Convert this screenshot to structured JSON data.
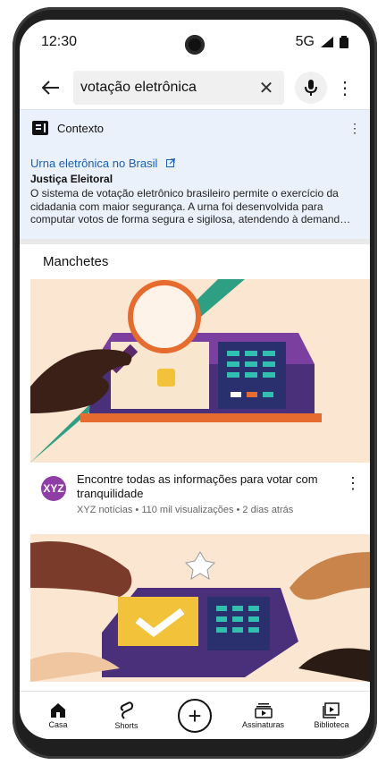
{
  "status": {
    "time": "12:30",
    "network": "5G"
  },
  "search": {
    "query": "votação eletrônica"
  },
  "context": {
    "title": "Contexto",
    "link": "Urna eletrônica no Brasil",
    "source": "Justiça Eleitoral",
    "description": "O sistema de votação eletrônico brasileiro permite o exercício da cidadania com maior segurança. A urna foi desenvolvida para computar votos de forma segura e sigilosa, atendendo à demand…"
  },
  "section_title": "Manchetes",
  "video": {
    "channel_avatar": "XYZ",
    "title": "Encontre todas as informações para votar com tranquilidade",
    "meta": "XYZ notícias • 110 mil visualizações • 2 dias atrás"
  },
  "bottom_nav": {
    "items": [
      {
        "label": "Casa"
      },
      {
        "label": "Shorts"
      },
      {
        "label": ""
      },
      {
        "label": "Assinaturas"
      },
      {
        "label": "Biblioteca"
      }
    ]
  },
  "colors": {
    "context_bg": "#eaf1fb",
    "link": "#1a5fb4",
    "thumb_bg": "#fbe6d1",
    "avatar": "#8e3ea4"
  },
  "icons": [
    "back-arrow-icon",
    "clear-icon",
    "mic-icon",
    "more-vert-icon",
    "context-icon",
    "external-link-icon",
    "home-icon",
    "shorts-icon",
    "create-plus-icon",
    "subscriptions-icon",
    "library-icon"
  ]
}
